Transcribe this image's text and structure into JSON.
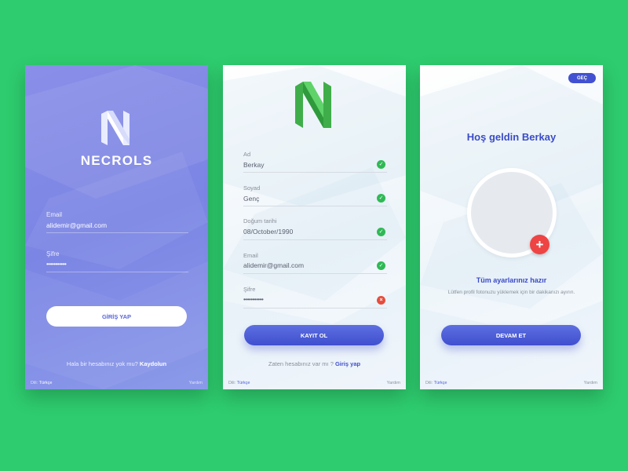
{
  "screen1": {
    "brand": "NECROLS",
    "email_label": "Email",
    "email_value": "alidemir@gmail.com",
    "password_label": "Şifre",
    "password_value": "•••••••••••",
    "login_button": "GİRİŞ YAP",
    "signup_prompt": "Hala bir hesabınız yok mu?",
    "signup_link": "Kaydolun",
    "footer_lang_label": "Dili:",
    "footer_lang_value": "Türkçe",
    "footer_help": "Yardım"
  },
  "screen2": {
    "fields": [
      {
        "label": "Ad",
        "value": "Berkay",
        "status": "valid"
      },
      {
        "label": "Soyad",
        "value": "Genç",
        "status": "valid"
      },
      {
        "label": "Doğum tarihi",
        "value": "08/October/1990",
        "status": "valid"
      },
      {
        "label": "Email",
        "value": "alidemir@gmail.com",
        "status": "valid"
      },
      {
        "label": "Şifre",
        "value": "•••••••••••",
        "status": "invalid"
      }
    ],
    "register_button": "KAYIT OL",
    "signin_prompt": "Zaten hesabınız var mı ?",
    "signin_link": "Giriş yap",
    "footer_lang_label": "Dili:",
    "footer_lang_value": "Türkçe",
    "footer_help": "Yardım"
  },
  "screen3": {
    "skip_button": "GEÇ",
    "welcome_title": "Hoş geldin Berkay",
    "ready_title": "Tüm ayarlarınız hazır",
    "ready_hint": "Lütfen profil fotonuzu yüklemek için bir dakikanızı ayırın.",
    "continue_button": "DEVAM ET",
    "add_photo_glyph": "+",
    "footer_lang_label": "Dili:",
    "footer_lang_value": "Türkçe",
    "footer_help": "Yardım"
  },
  "icons": {
    "valid": "check-icon",
    "invalid": "close-icon",
    "add": "plus-icon"
  },
  "colors": {
    "background": "#2ecc6e",
    "primary": "#4251d1",
    "valid": "#2fb955",
    "invalid": "#e74c3c",
    "add_photo": "#ee4444"
  }
}
